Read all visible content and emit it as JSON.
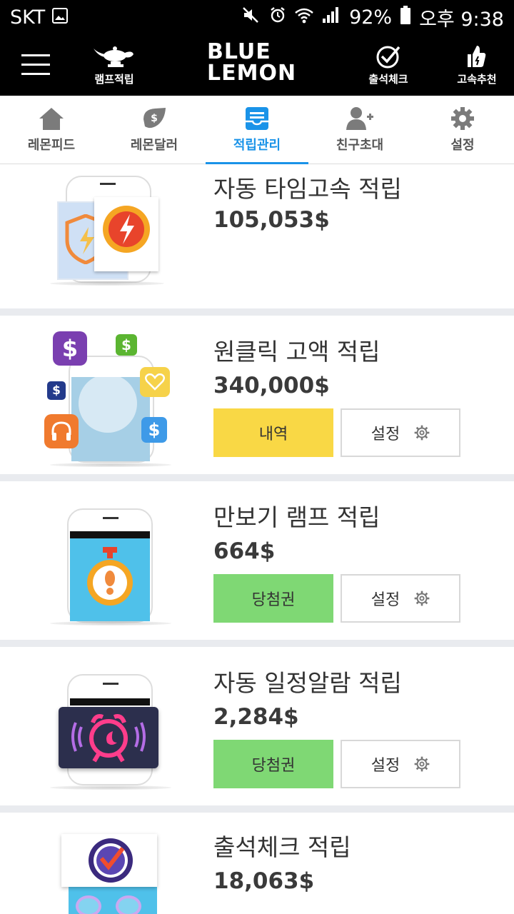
{
  "status_bar": {
    "carrier": "SKT",
    "battery": "92%",
    "time": "오후 9:38"
  },
  "header": {
    "menu_icon": "hamburger-icon",
    "lamp_label": "램프적립",
    "logo_line1": "BLUE",
    "logo_line2": "LEMON",
    "attendance_label": "출석체크",
    "recommend_label": "고속추천"
  },
  "tabs": [
    {
      "label": "레몬피드",
      "icon": "home-icon"
    },
    {
      "label": "레몬달러",
      "icon": "dollar-leaf-icon"
    },
    {
      "label": "적립관리",
      "icon": "inbox-icon"
    },
    {
      "label": "친구초대",
      "icon": "add-user-icon"
    },
    {
      "label": "설정",
      "icon": "gear-icon"
    }
  ],
  "active_tab": "적립관리",
  "colors": {
    "accent": "#1a93e8",
    "history_button": "#f9d845",
    "ticket_button": "#7fd874"
  },
  "cards": [
    {
      "title": "자동 타임고속 적립",
      "amount": "105,053$"
    },
    {
      "title": "원클릭 고액 적립",
      "amount": "340,000$",
      "primary_button": "내역",
      "setting_button": "설정"
    },
    {
      "title": "만보기 램프 적립",
      "amount": "664$",
      "primary_button": "당첨권",
      "setting_button": "설정"
    },
    {
      "title": "자동 일정알람 적립",
      "amount": "2,284$",
      "primary_button": "당첨권",
      "setting_button": "설정"
    },
    {
      "title": "출석체크 적립",
      "amount": "18,063$"
    }
  ]
}
